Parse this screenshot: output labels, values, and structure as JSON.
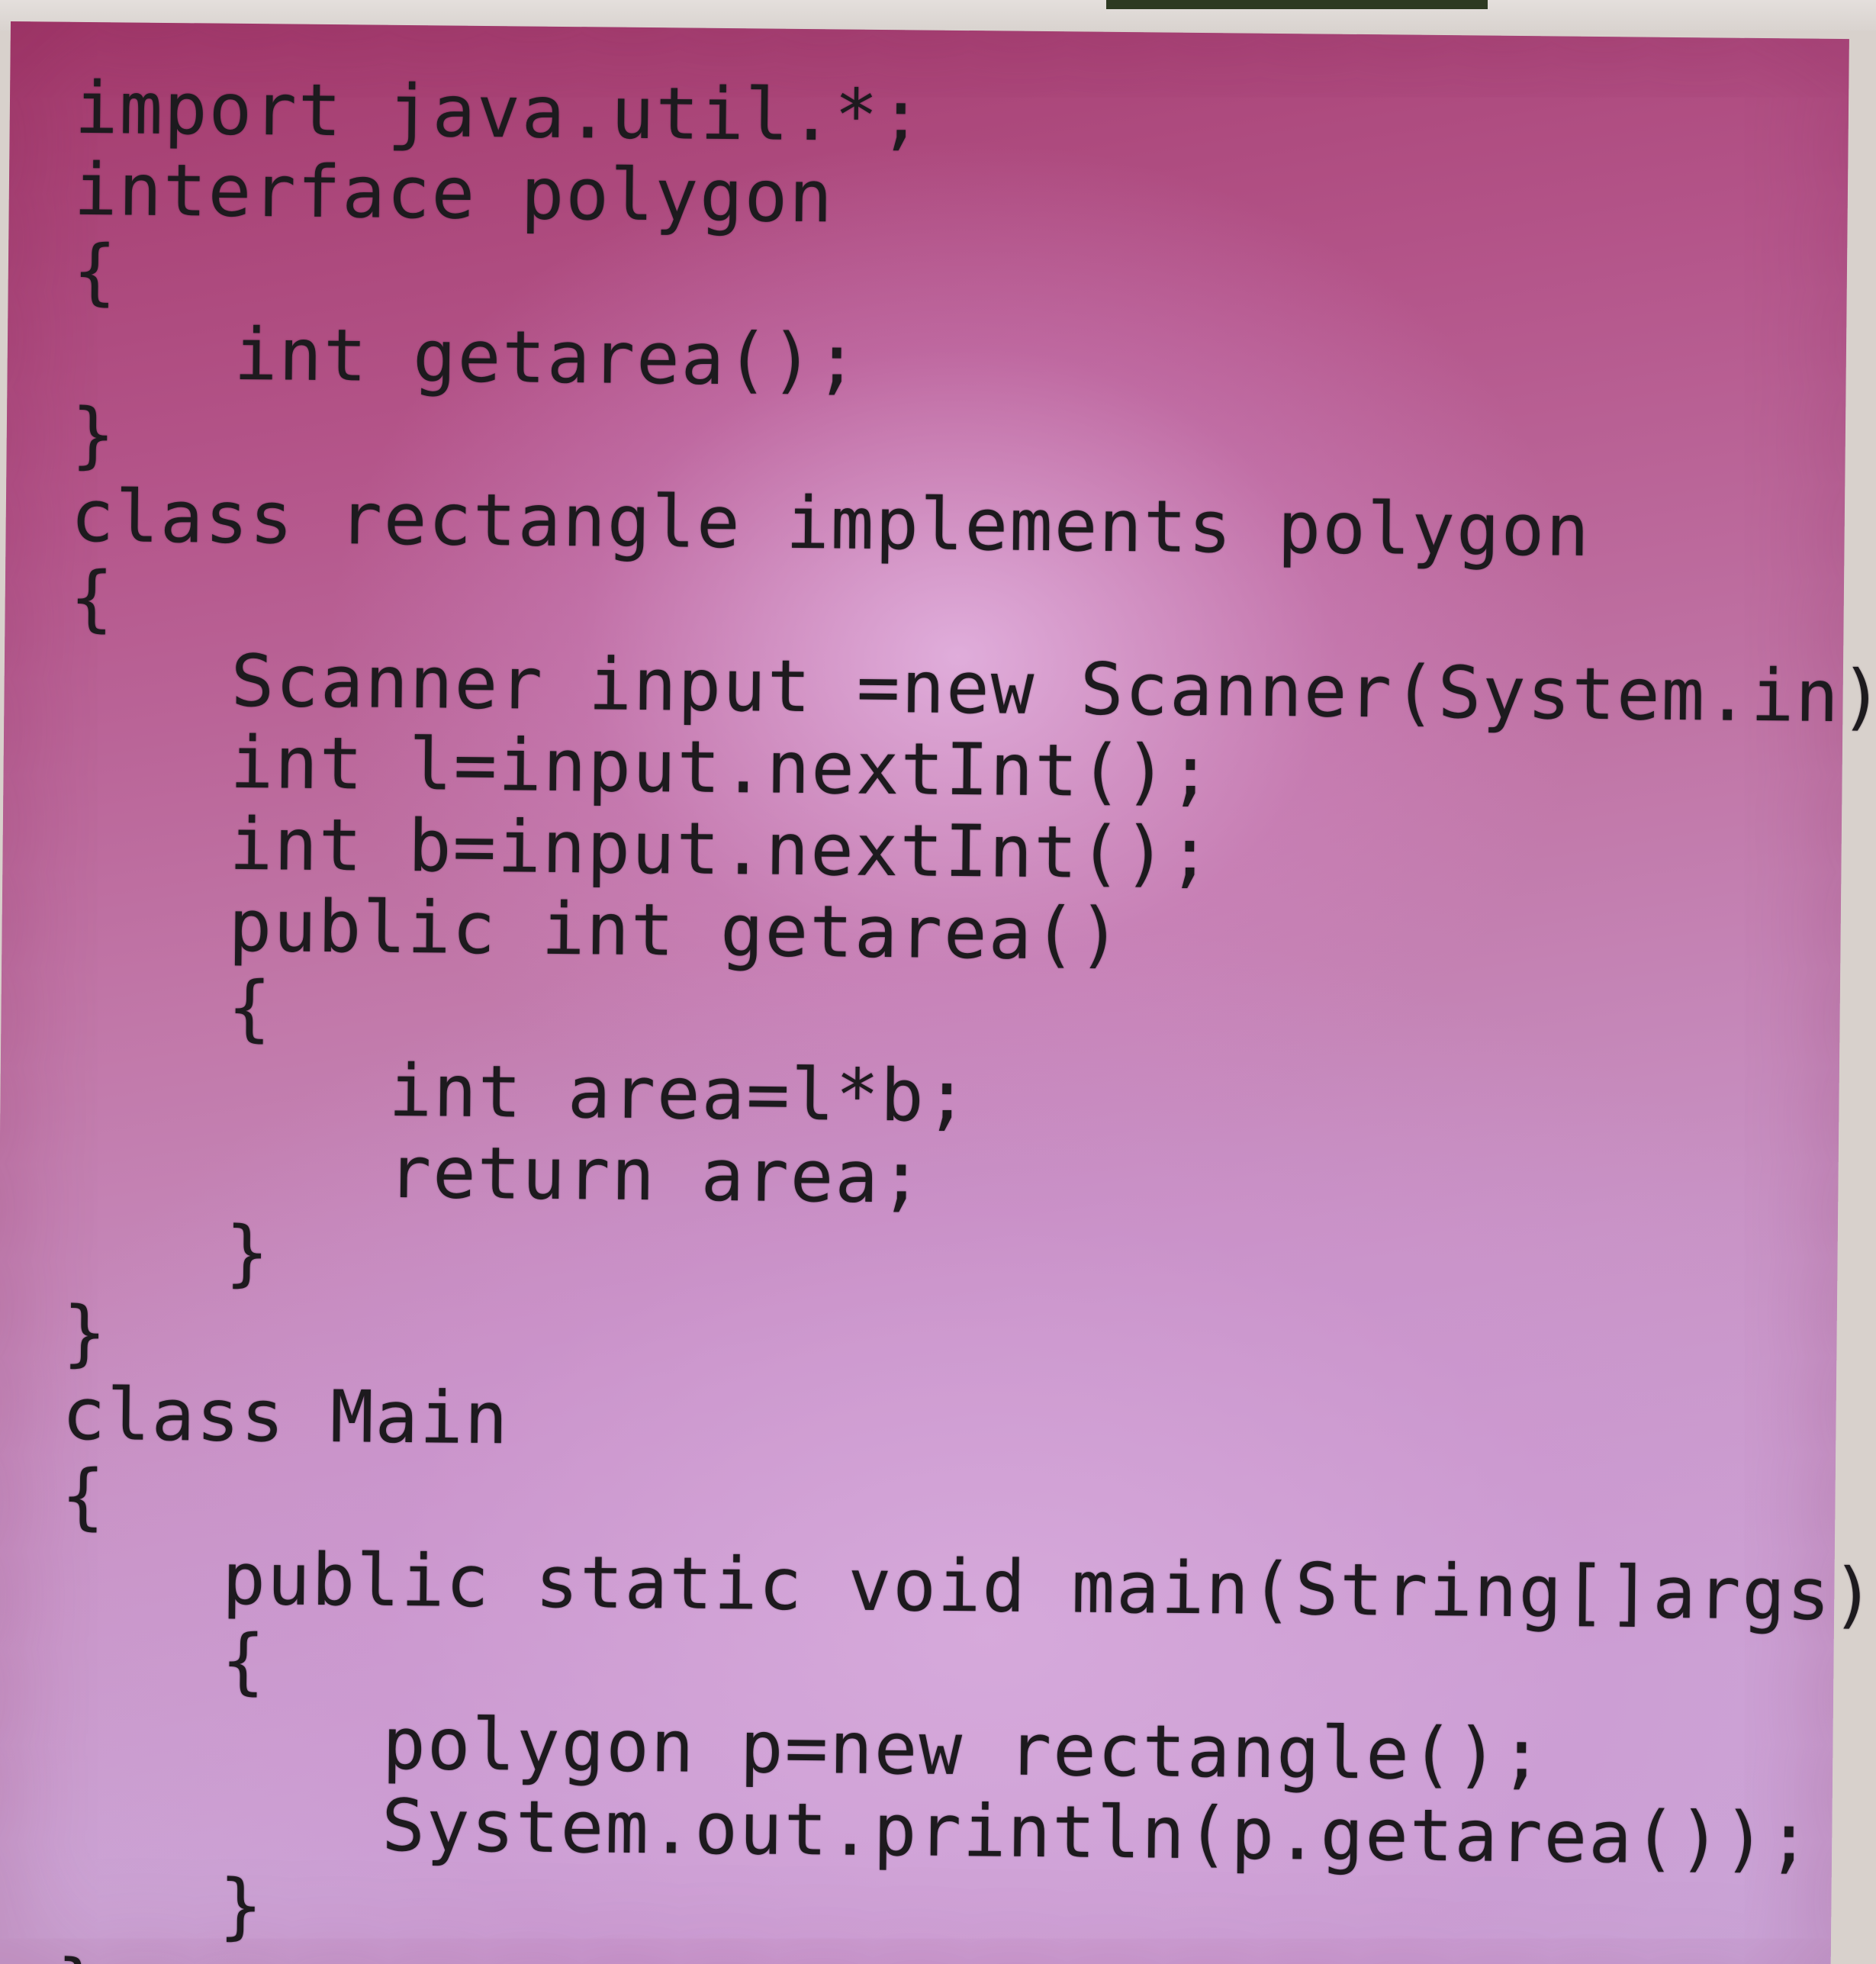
{
  "code": {
    "language": "java",
    "lines": [
      "import java.util.*;",
      "interface polygon",
      "{",
      "int getarea();",
      "}",
      "class rectangle implements polygon",
      "{",
      "Scanner input =new Scanner(System.in);",
      "int l=input.nextInt();",
      "int b=input.nextInt();",
      "public int getarea()",
      "{",
      "int area=l*b;",
      "return area;",
      "}",
      "}",
      "class Main",
      "{",
      "public static void main(String[]args)",
      "{",
      "polygon p=new rectangle();",
      "System.out.println(p.getarea());",
      "}",
      "}"
    ]
  },
  "colors": {
    "text": "#1d1a1e",
    "background_top": "#a33a6c",
    "background_bottom": "#c9a7d8"
  }
}
